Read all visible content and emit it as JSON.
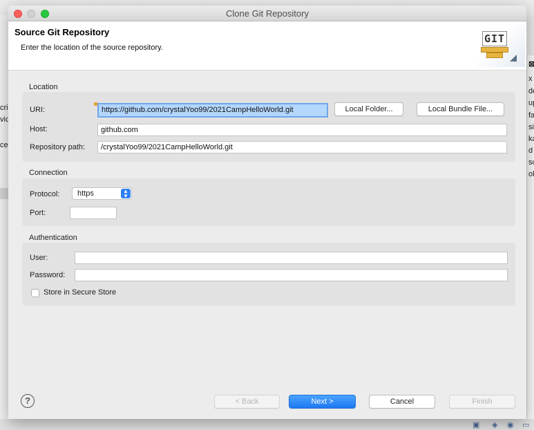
{
  "window": {
    "title": "Clone Git Repository"
  },
  "header": {
    "title": "Source Git Repository",
    "subtitle": "Enter the location of the source repository.",
    "logo_text": "GIT"
  },
  "location": {
    "section_label": "Location",
    "uri_label": "URI:",
    "uri_value": "https://github.com/crystalYoo99/2021CampHelloWorld.git",
    "local_folder_button": "Local Folder...",
    "local_bundle_button": "Local Bundle File...",
    "host_label": "Host:",
    "host_value": "github.com",
    "repo_path_label": "Repository path:",
    "repo_path_value": "/crystalYoo99/2021CampHelloWorld.git"
  },
  "connection": {
    "section_label": "Connection",
    "protocol_label": "Protocol:",
    "protocol_value": "https",
    "port_label": "Port:",
    "port_value": ""
  },
  "authentication": {
    "section_label": "Authentication",
    "user_label": "User:",
    "user_value": "",
    "password_label": "Password:",
    "password_value": "",
    "store_label": "Store in Secure Store",
    "store_checked": false
  },
  "footer": {
    "help_icon": "?",
    "back_button": "< Back",
    "next_button": "Next >",
    "cancel_button": "Cancel",
    "finish_button": "Finish"
  },
  "background": {
    "left_fragments": [
      "cri",
      "vic",
      "ce"
    ],
    "right_fragments": [
      "x",
      "de",
      "up",
      "fa",
      "si",
      "ka",
      "d",
      "sc",
      "ol"
    ],
    "right_close_icon": "⊠"
  },
  "colors": {
    "primary_button": "#1d78f0",
    "focus_field": "#b3d7ff",
    "close": "#fc5f57",
    "maximize": "#29c840"
  }
}
